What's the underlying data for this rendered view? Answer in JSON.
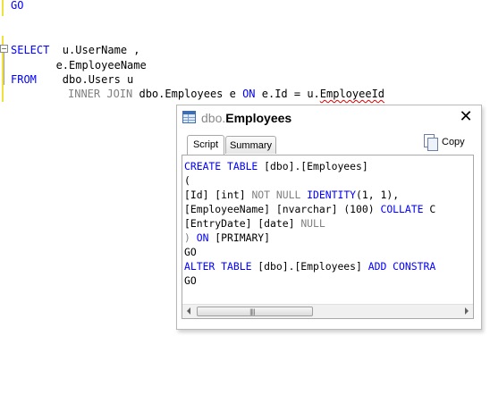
{
  "editor": {
    "line_go_top": "GO",
    "line_select_kw": "SELECT",
    "line_select_rest": "  u.UserName ,",
    "line_employee_name": "       e.EmployeeName",
    "line_from_kw": "FROM",
    "line_from_rest": "    dbo.Users u",
    "join_inner": "INNER JOIN",
    "join_table": " dbo.Employees e ",
    "join_on": "ON",
    "join_cond": " e.Id = u.",
    "join_squiggle": "EmployeeId",
    "collapse_symbol": "−"
  },
  "popup": {
    "title_schema": "dbo.",
    "title_name": "Employees",
    "close_symbol": "✕",
    "tabs": [
      {
        "label": "Script"
      },
      {
        "label": "Summary"
      }
    ],
    "copy_label": "Copy",
    "script_lines": {
      "l1_kw": "CREATE TABLE",
      "l1_rest": " [dbo].[Employees]",
      "l2": "(",
      "l3_a": "[Id] [int] ",
      "l3_b": "NOT NULL",
      "l3_c": " ",
      "l3_d": "IDENTITY",
      "l3_e": "(1, 1),",
      "l4_a": "[EmployeeName] [nvarchar] ",
      "l4_b": "(100)",
      "l4_c": " ",
      "l4_d": "COLLATE",
      "l4_e": " C",
      "l5_a": "[EntryDate] [date] ",
      "l5_b": "NULL",
      "l6_a": ")",
      "l6_b": " ON",
      "l6_c": " [PRIMARY]",
      "l7": "GO",
      "l8_kw": "ALTER TABLE",
      "l8_rest": " [dbo].[Employees] ",
      "l8_kw2": "ADD CONSTRA",
      "l9": "GO"
    },
    "scrollbar_grip": "||||"
  }
}
